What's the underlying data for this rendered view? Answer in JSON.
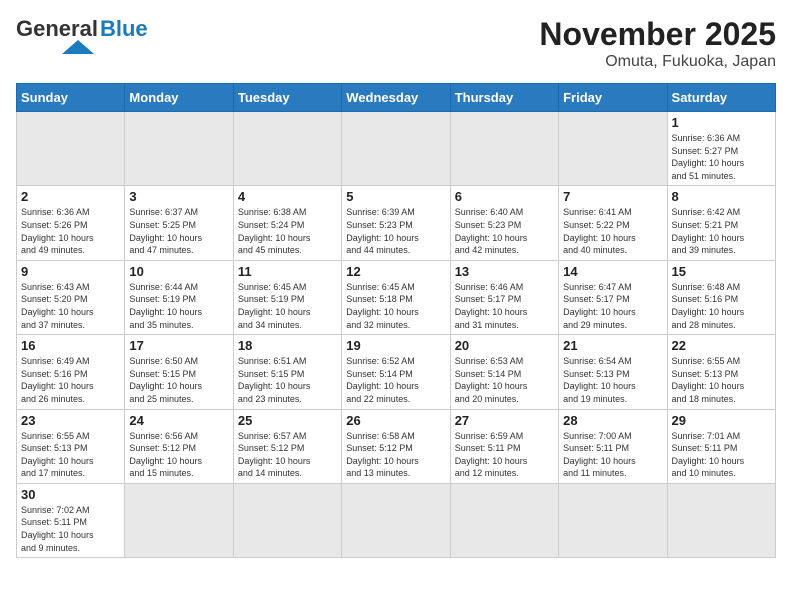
{
  "header": {
    "logo_general": "General",
    "logo_blue": "Blue",
    "title": "November 2025",
    "subtitle": "Omuta, Fukuoka, Japan"
  },
  "days_of_week": [
    "Sunday",
    "Monday",
    "Tuesday",
    "Wednesday",
    "Thursday",
    "Friday",
    "Saturday"
  ],
  "weeks": [
    {
      "days": [
        {
          "num": "",
          "info": ""
        },
        {
          "num": "",
          "info": ""
        },
        {
          "num": "",
          "info": ""
        },
        {
          "num": "",
          "info": ""
        },
        {
          "num": "",
          "info": ""
        },
        {
          "num": "",
          "info": ""
        },
        {
          "num": "1",
          "info": "Sunrise: 6:36 AM\nSunset: 5:27 PM\nDaylight: 10 hours\nand 51 minutes."
        }
      ]
    },
    {
      "days": [
        {
          "num": "2",
          "info": "Sunrise: 6:36 AM\nSunset: 5:26 PM\nDaylight: 10 hours\nand 49 minutes."
        },
        {
          "num": "3",
          "info": "Sunrise: 6:37 AM\nSunset: 5:25 PM\nDaylight: 10 hours\nand 47 minutes."
        },
        {
          "num": "4",
          "info": "Sunrise: 6:38 AM\nSunset: 5:24 PM\nDaylight: 10 hours\nand 45 minutes."
        },
        {
          "num": "5",
          "info": "Sunrise: 6:39 AM\nSunset: 5:23 PM\nDaylight: 10 hours\nand 44 minutes."
        },
        {
          "num": "6",
          "info": "Sunrise: 6:40 AM\nSunset: 5:23 PM\nDaylight: 10 hours\nand 42 minutes."
        },
        {
          "num": "7",
          "info": "Sunrise: 6:41 AM\nSunset: 5:22 PM\nDaylight: 10 hours\nand 40 minutes."
        },
        {
          "num": "8",
          "info": "Sunrise: 6:42 AM\nSunset: 5:21 PM\nDaylight: 10 hours\nand 39 minutes."
        }
      ]
    },
    {
      "days": [
        {
          "num": "9",
          "info": "Sunrise: 6:43 AM\nSunset: 5:20 PM\nDaylight: 10 hours\nand 37 minutes."
        },
        {
          "num": "10",
          "info": "Sunrise: 6:44 AM\nSunset: 5:19 PM\nDaylight: 10 hours\nand 35 minutes."
        },
        {
          "num": "11",
          "info": "Sunrise: 6:45 AM\nSunset: 5:19 PM\nDaylight: 10 hours\nand 34 minutes."
        },
        {
          "num": "12",
          "info": "Sunrise: 6:45 AM\nSunset: 5:18 PM\nDaylight: 10 hours\nand 32 minutes."
        },
        {
          "num": "13",
          "info": "Sunrise: 6:46 AM\nSunset: 5:17 PM\nDaylight: 10 hours\nand 31 minutes."
        },
        {
          "num": "14",
          "info": "Sunrise: 6:47 AM\nSunset: 5:17 PM\nDaylight: 10 hours\nand 29 minutes."
        },
        {
          "num": "15",
          "info": "Sunrise: 6:48 AM\nSunset: 5:16 PM\nDaylight: 10 hours\nand 28 minutes."
        }
      ]
    },
    {
      "days": [
        {
          "num": "16",
          "info": "Sunrise: 6:49 AM\nSunset: 5:16 PM\nDaylight: 10 hours\nand 26 minutes."
        },
        {
          "num": "17",
          "info": "Sunrise: 6:50 AM\nSunset: 5:15 PM\nDaylight: 10 hours\nand 25 minutes."
        },
        {
          "num": "18",
          "info": "Sunrise: 6:51 AM\nSunset: 5:15 PM\nDaylight: 10 hours\nand 23 minutes."
        },
        {
          "num": "19",
          "info": "Sunrise: 6:52 AM\nSunset: 5:14 PM\nDaylight: 10 hours\nand 22 minutes."
        },
        {
          "num": "20",
          "info": "Sunrise: 6:53 AM\nSunset: 5:14 PM\nDaylight: 10 hours\nand 20 minutes."
        },
        {
          "num": "21",
          "info": "Sunrise: 6:54 AM\nSunset: 5:13 PM\nDaylight: 10 hours\nand 19 minutes."
        },
        {
          "num": "22",
          "info": "Sunrise: 6:55 AM\nSunset: 5:13 PM\nDaylight: 10 hours\nand 18 minutes."
        }
      ]
    },
    {
      "days": [
        {
          "num": "23",
          "info": "Sunrise: 6:55 AM\nSunset: 5:13 PM\nDaylight: 10 hours\nand 17 minutes."
        },
        {
          "num": "24",
          "info": "Sunrise: 6:56 AM\nSunset: 5:12 PM\nDaylight: 10 hours\nand 15 minutes."
        },
        {
          "num": "25",
          "info": "Sunrise: 6:57 AM\nSunset: 5:12 PM\nDaylight: 10 hours\nand 14 minutes."
        },
        {
          "num": "26",
          "info": "Sunrise: 6:58 AM\nSunset: 5:12 PM\nDaylight: 10 hours\nand 13 minutes."
        },
        {
          "num": "27",
          "info": "Sunrise: 6:59 AM\nSunset: 5:11 PM\nDaylight: 10 hours\nand 12 minutes."
        },
        {
          "num": "28",
          "info": "Sunrise: 7:00 AM\nSunset: 5:11 PM\nDaylight: 10 hours\nand 11 minutes."
        },
        {
          "num": "29",
          "info": "Sunrise: 7:01 AM\nSunset: 5:11 PM\nDaylight: 10 hours\nand 10 minutes."
        }
      ]
    },
    {
      "days": [
        {
          "num": "30",
          "info": "Sunrise: 7:02 AM\nSunset: 5:11 PM\nDaylight: 10 hours\nand 9 minutes."
        },
        {
          "num": "",
          "info": ""
        },
        {
          "num": "",
          "info": ""
        },
        {
          "num": "",
          "info": ""
        },
        {
          "num": "",
          "info": ""
        },
        {
          "num": "",
          "info": ""
        },
        {
          "num": "",
          "info": ""
        }
      ]
    }
  ]
}
